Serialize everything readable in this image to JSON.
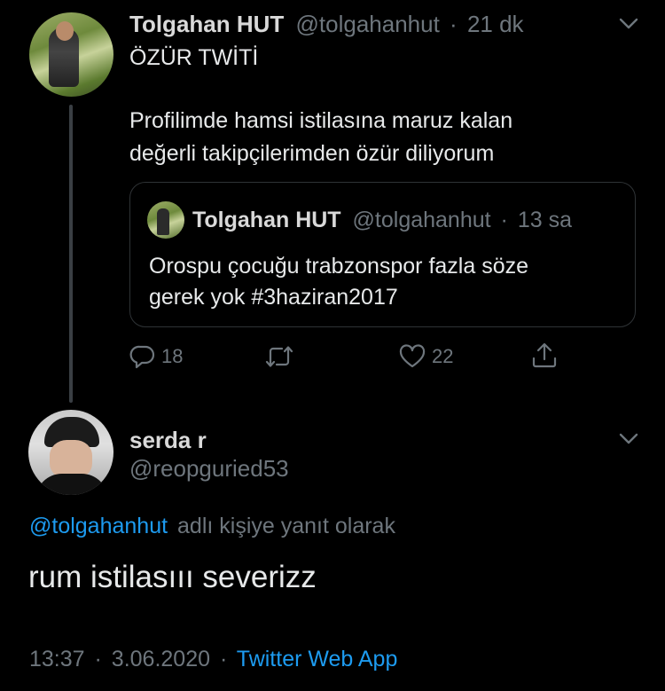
{
  "tweet": {
    "author_name": "Tolgahan HUT",
    "author_handle": "@tolgahanhut",
    "separator": "·",
    "time": "21 dk",
    "title_line": "ÖZÜR TWİTİ",
    "body_line1": "Profilimde hamsi istilasına maruz kalan",
    "body_line2": "değerli takipçilerimden özür diliyorum",
    "quote": {
      "author_name": "Tolgahan HUT",
      "author_handle": "@tolgahanhut",
      "separator": "·",
      "time": "13 sa",
      "body_line1": "Orospu çocuğu trabzonspor fazla söze",
      "body_line2": "gerek yok #3haziran2017"
    },
    "actions": {
      "reply_count": "18",
      "retweet_count": "",
      "like_count": "22"
    }
  },
  "reply": {
    "author_name": "serda r",
    "author_handle": "@reopguried53",
    "replying_to_handle": "@tolgahanhut",
    "replying_to_suffix": "adlı kişiye yanıt olarak",
    "text": "rum istilasııı severizz",
    "time": "13:37",
    "separator1": "·",
    "date": "3.06.2020",
    "separator2": "·",
    "source": "Twitter Web App"
  },
  "icons": {
    "menu": "chevron-down-icon",
    "reply": "reply-icon",
    "retweet": "retweet-icon",
    "like": "heart-icon",
    "share": "share-icon"
  },
  "colors": {
    "background": "#000000",
    "text": "#d9d9d9",
    "muted": "#6e767d",
    "link": "#1d9bf0",
    "border": "#2f3336"
  }
}
